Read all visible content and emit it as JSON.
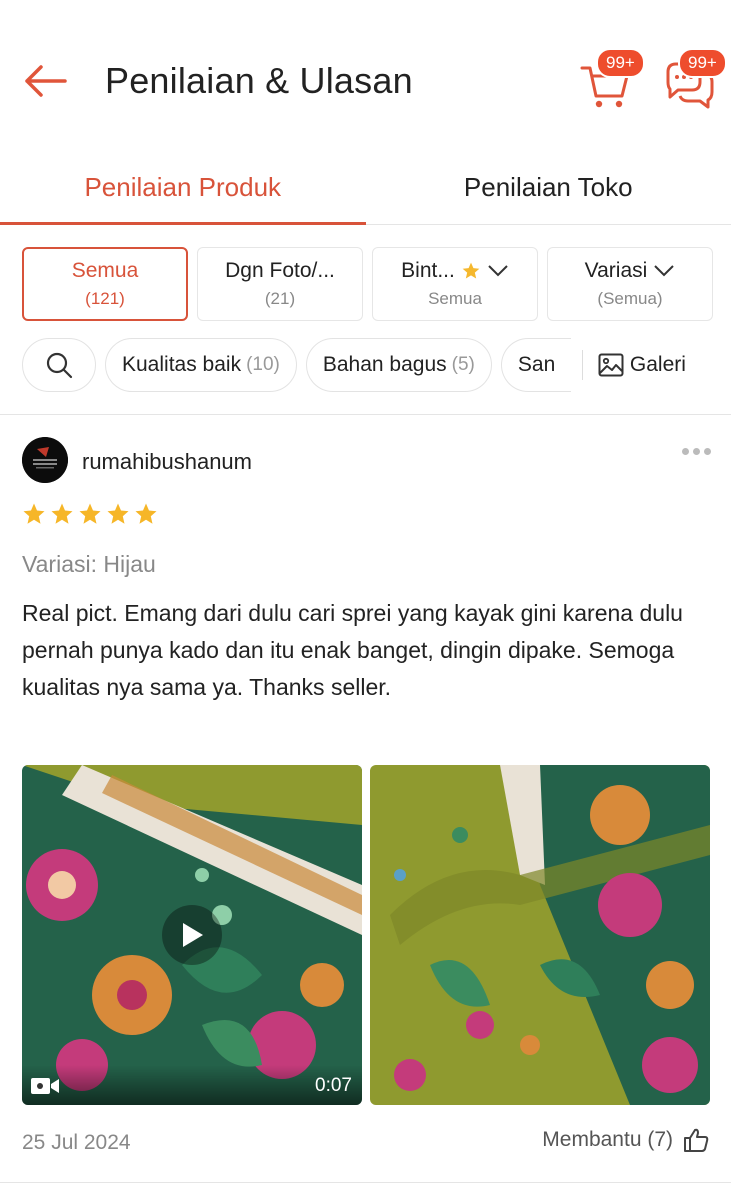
{
  "header": {
    "title": "Penilaian & Ulasan",
    "cart_badge": "99+",
    "chat_badge": "99+",
    "accent_color": "#ee4d2d"
  },
  "tabs": [
    {
      "label": "Penilaian Produk",
      "active": true
    },
    {
      "label": "Penilaian Toko",
      "active": false
    }
  ],
  "filters": [
    {
      "label": "Semua",
      "sub": "(121)",
      "active": true
    },
    {
      "label": "Dgn Foto/...",
      "sub": "(21)",
      "active": false
    },
    {
      "label": "Bint...",
      "sub": "Semua",
      "icon": "star-icon",
      "dropdown": true
    },
    {
      "label": "Variasi",
      "sub": "(Semua)",
      "dropdown": true
    }
  ],
  "chips": [
    {
      "label": "Kualitas baik",
      "count": "(10)"
    },
    {
      "label": "Bahan bagus",
      "count": "(5)"
    },
    {
      "label": "San"
    }
  ],
  "gallery_label": "Galeri",
  "review": {
    "username": "rumahibushanum",
    "rating": 5,
    "variation": "Variasi: Hijau",
    "text": "Real pict. Emang dari dulu cari sprei yang kayak gini karena dulu pernah punya kado dan itu enak banget, dingin dipake. Semoga kualitas nya sama ya. Thanks seller.",
    "video_duration": "0:07",
    "date": "25 Jul 2024",
    "helpful_label": "Membantu (7)"
  }
}
